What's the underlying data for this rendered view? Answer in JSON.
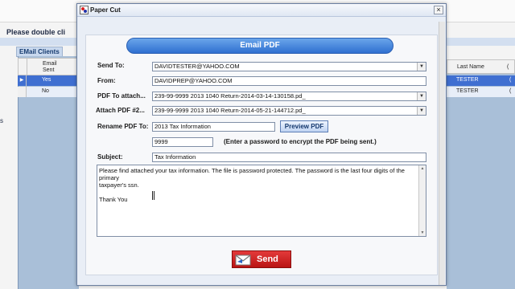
{
  "background": {
    "prompt_text": "Please double cli",
    "email_clients_label": "EMail Clients",
    "grid_header": "Email\nSent",
    "rows": [
      {
        "indicator": "▶",
        "value": "Yes"
      },
      {
        "indicator": "",
        "value": "No"
      }
    ],
    "left_edge_text": "s",
    "right_grid": {
      "header": "Last Name",
      "header2": "(",
      "rows": [
        {
          "last_name": "TESTER",
          "extra": "("
        },
        {
          "last_name": "TESTER",
          "extra": "("
        }
      ]
    }
  },
  "dialog": {
    "title": "Paper Cut",
    "close_glyph": "×",
    "header": "Email PDF",
    "labels": {
      "send_to": "Send To:",
      "from": "From:",
      "pdf_to_attach": "PDF To attach...",
      "attach_pdf_2": "Attach PDF #2...",
      "rename_pdf": "Rename PDF To:",
      "subject": "Subject:"
    },
    "fields": {
      "send_to": "DAVIDTESTER@YAHOO.COM",
      "from": "DAVIDPREP@YAHOO.COM",
      "pdf_to_attach": "239-99-9999 2013 1040 Return-2014-03-14-130158.pd_",
      "attach_pdf_2": "239-99-9999 2013 1040 Return-2014-05-21-144712.pd_",
      "rename_pdf": "2013 Tax Information",
      "password": "9999",
      "subject": "Tax Information"
    },
    "password_note": "(Enter a password to encrypt the PDF being sent.)",
    "preview_button": "Preview PDF",
    "message": {
      "line1": "Please find attached your tax information.  The file is password protected.  The password is the last four digits of the primary",
      "line2": "taxpayer's ssn.",
      "line3": "Thank You"
    },
    "send_button": "Send",
    "dropdown_glyph": "▼",
    "scroll_up": "▲",
    "scroll_down": "▼"
  },
  "colors": {
    "header_pill": "#2f6fd0",
    "send_button": "#c81e1e",
    "selected_row": "#3f6fd1"
  },
  "icons": [
    "paper-cut-app-icon",
    "close-icon",
    "dropdown-arrow-icon",
    "envelope-send-icon",
    "text-cursor-icon"
  ]
}
